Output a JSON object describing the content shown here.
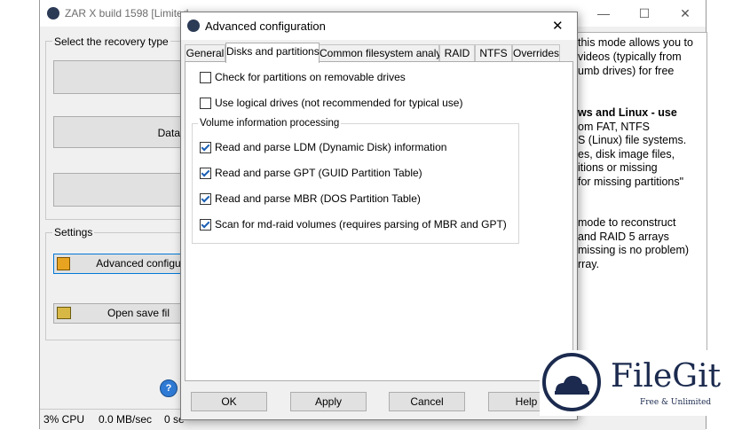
{
  "main_window": {
    "title": "ZAR X build 1598 [Limited",
    "recovery_group_label": "Select the recovery type",
    "recovery_buttons": [
      "",
      "Data",
      ""
    ],
    "settings_group_label": "Settings",
    "advanced_button_label": "Advanced configu",
    "open_save_button_label": "Open save fil",
    "help_lines": [
      "this mode allows you to",
      "videos (typically from",
      "umb drives) for free",
      "ws and Linux - use",
      "om FAT, NTFS",
      "S (Linux) file systems.",
      "es, disk image files,",
      "itions or missing",
      "for missing partitions\"",
      "mode to reconstruct",
      "and RAID 5 arrays",
      "missing is no problem)",
      "rray."
    ],
    "status": {
      "cpu": "3% CPU",
      "speed": "0.0 MB/sec",
      "sec": "0 se"
    }
  },
  "dialog": {
    "title": "Advanced configuration",
    "tabs": [
      "General",
      "Disks and partitions",
      "Common filesystem analysis",
      "RAID",
      "NTFS",
      "Overrides"
    ],
    "active_tab": "Disks and partitions",
    "options": [
      {
        "label": "Check for partitions on  removable drives",
        "checked": false
      },
      {
        "label": "Use logical drives (not recommended for typical use)",
        "checked": false
      }
    ],
    "volume_group_label": "Volume information processing",
    "volume_options": [
      {
        "label": "Read and parse LDM (Dynamic Disk) information",
        "checked": true
      },
      {
        "label": "Read and parse GPT (GUID Partition Table)",
        "checked": true
      },
      {
        "label": "Read and parse MBR (DOS Partition Table)",
        "checked": true
      },
      {
        "label": "Scan for md-raid volumes (requires parsing of MBR and GPT)",
        "checked": true
      }
    ],
    "buttons": {
      "ok": "OK",
      "apply": "Apply",
      "cancel": "Cancel",
      "help": "Help"
    }
  },
  "watermark": {
    "brand": "FileGit",
    "tagline": "Free & Unlimited"
  },
  "colors": {
    "accent": "#1a5fb4",
    "logo_navy": "#1b2a4e"
  }
}
